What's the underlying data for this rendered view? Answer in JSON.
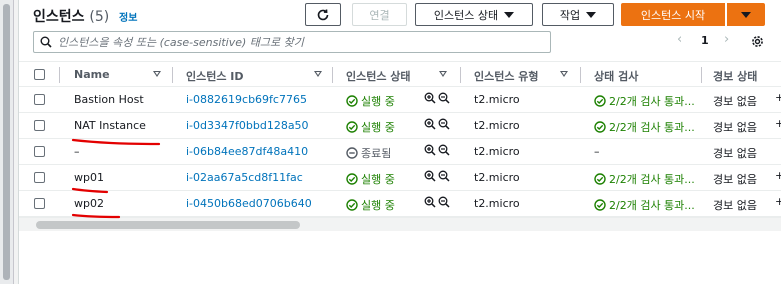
{
  "header": {
    "title": "인스턴스",
    "count": "(5)",
    "info_link": "정보"
  },
  "toolbar": {
    "refresh_icon": "refresh-icon",
    "connect_label": "연결",
    "instance_state_label": "인스턴스 상태",
    "actions_label": "작업",
    "launch_label": "인스턴스 시작"
  },
  "search": {
    "placeholder": "인스턴스을 속성 또는 (case-sensitive) 태그로 찾기"
  },
  "pagination": {
    "current_page": "1"
  },
  "table": {
    "columns": [
      "Name",
      "인스턴스 ID",
      "인스턴스 상태",
      "인스턴스 유형",
      "상태 검사",
      "경보 상태"
    ],
    "rows": [
      {
        "name": "Bastion Host",
        "id": "i-0882619cb69fc7765",
        "state": "실행 중",
        "state_type": "running",
        "type": "t2.micro",
        "check": "2/2개 검사 통과...",
        "alarm": "경보 없음"
      },
      {
        "name": "NAT Instance",
        "id": "i-0d3347f0bbd128a50",
        "state": "실행 중",
        "state_type": "running",
        "type": "t2.micro",
        "check": "2/2개 검사 통과...",
        "alarm": "경보 없음"
      },
      {
        "name": "–",
        "id": "i-06b84ee87df48a410",
        "state": "종료됨",
        "state_type": "terminated",
        "type": "t2.micro",
        "check": "–",
        "alarm": "경보 없음"
      },
      {
        "name": "wp01",
        "id": "i-02aa67a5cd8f11fac",
        "state": "실행 중",
        "state_type": "running",
        "type": "t2.micro",
        "check": "2/2개 검사 통과...",
        "alarm": "경보 없음"
      },
      {
        "name": "wp02",
        "id": "i-0450b68ed0706b640",
        "state": "실행 중",
        "state_type": "running",
        "type": "t2.micro",
        "check": "2/2개 검사 통과...",
        "alarm": "경보 없음"
      }
    ]
  },
  "colors": {
    "accent": "#ec7211",
    "link": "#0073bb",
    "success": "#1d8102",
    "annotation": "#e30000"
  }
}
